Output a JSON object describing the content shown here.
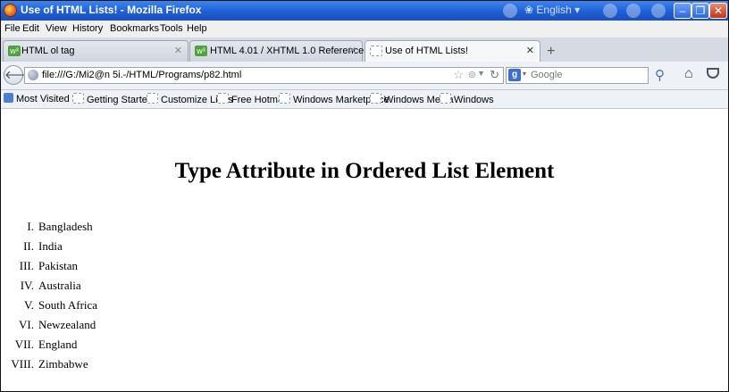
{
  "window": {
    "title": "Use of HTML Lists! - Mozilla Firefox",
    "language_widget": "English"
  },
  "menu": [
    "File",
    "Edit",
    "View",
    "History",
    "Bookmarks",
    "Tools",
    "Help"
  ],
  "tabs": [
    {
      "label": "HTML ol tag"
    },
    {
      "label": "HTML 4.01 / XHTML 1.0 Reference"
    },
    {
      "label": "Use of HTML Lists!"
    }
  ],
  "nav": {
    "url": "file:///G:/Mi2@n 5i.-/HTML/Programs/p82.html",
    "search_engine": "Google"
  },
  "bookmarks": [
    "Most Visited",
    "Getting Started",
    "Customize Links",
    "Free Hotmail",
    "Windows Marketplace",
    "Windows Media",
    "Windows"
  ],
  "page": {
    "heading": "Type Attribute in Ordered List Element",
    "items": [
      {
        "num": "I.",
        "text": "Bangladesh"
      },
      {
        "num": "II.",
        "text": "India"
      },
      {
        "num": "III.",
        "text": "Pakistan"
      },
      {
        "num": "IV.",
        "text": "Australia"
      },
      {
        "num": "V.",
        "text": "South Africa"
      },
      {
        "num": "VI.",
        "text": "Newzealand"
      },
      {
        "num": "VII.",
        "text": "England"
      },
      {
        "num": "VIII.",
        "text": "Zimbabwe"
      }
    ]
  }
}
